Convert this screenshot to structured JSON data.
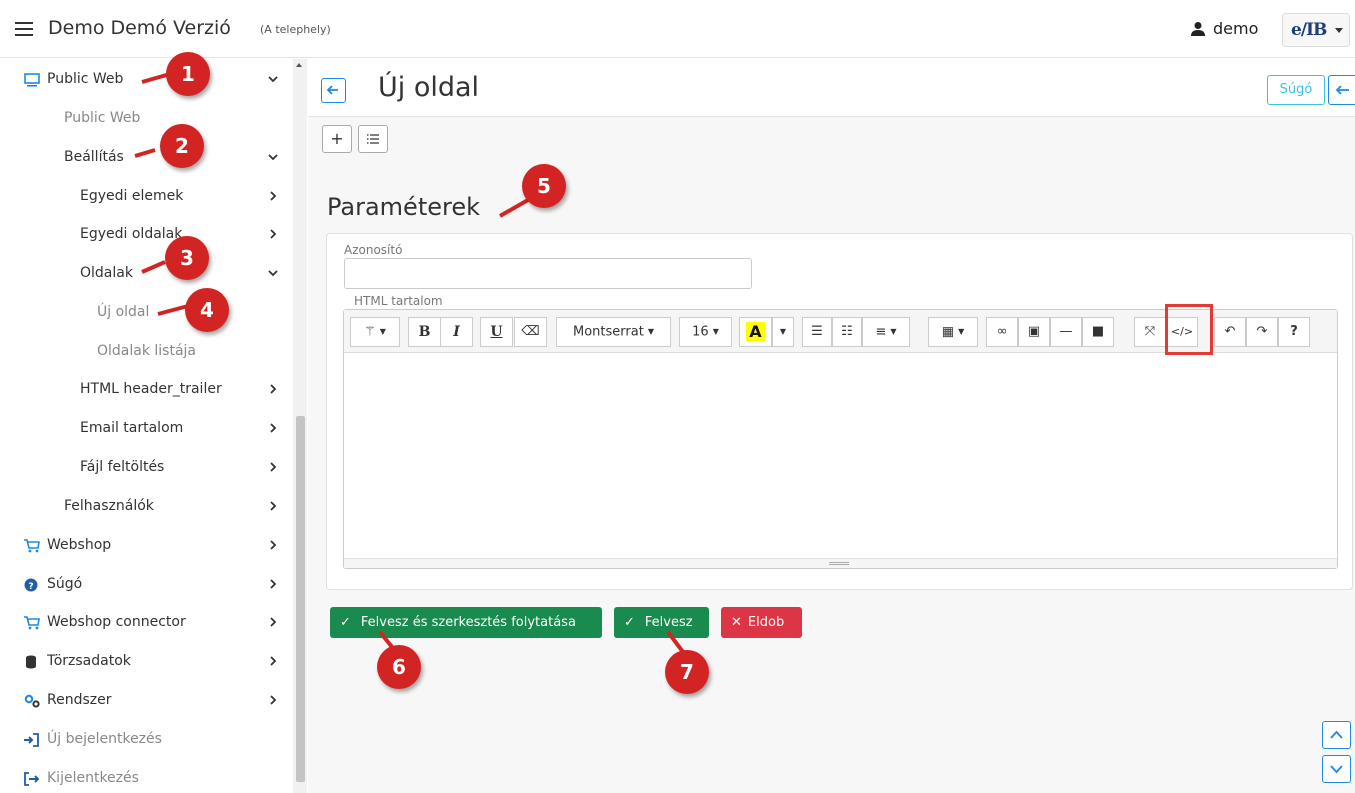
{
  "topbar": {
    "title": "Demo Demó Verzió",
    "site": "(A telephely)",
    "user": "demo",
    "logo": "e/IB"
  },
  "sidebar": {
    "public_web": "Public Web",
    "public_web_sub": "Public Web",
    "beallitas": "Beállítás",
    "egyedi_elemek": "Egyedi elemek",
    "egyedi_oldalak": "Egyedi oldalak",
    "oldalak": "Oldalak",
    "uj_oldal": "Új oldal",
    "oldalak_listaja": "Oldalak listája",
    "html_header": "HTML header_trailer",
    "email": "Email tartalom",
    "fajl": "Fájl feltöltés",
    "felhasznalok": "Felhasználók",
    "webshop": "Webshop",
    "sugo": "Súgó",
    "webshop_connector": "Webshop connector",
    "torzsadatok": "Törzsadatok",
    "rendszer": "Rendszer",
    "uj_bejelentkezes": "Új bejelentkezés",
    "kijelentkezes": "Kijelentkezés"
  },
  "page": {
    "title": "Új oldal",
    "help": "Súgó",
    "section": "Paraméterek"
  },
  "form": {
    "id_label": "Azonosító",
    "id_value": "",
    "html_label": "HTML tartalom"
  },
  "editor": {
    "font": "Montserrat",
    "size": "16"
  },
  "actions": {
    "save_continue": "Felvesz és szerkesztés folytatása",
    "save": "Felvesz",
    "discard": "Eldob"
  },
  "annotations": [
    "1",
    "2",
    "3",
    "4",
    "5",
    "6",
    "7"
  ],
  "colors": {
    "primary": "#1e88e5",
    "success": "#1a8b4f",
    "danger": "#dc3545",
    "marker": "#d32424",
    "info": "#3dc1e5"
  }
}
